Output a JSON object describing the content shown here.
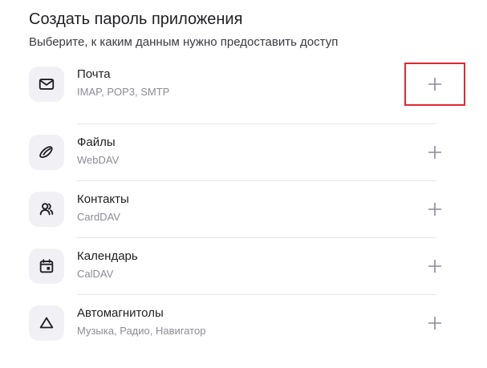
{
  "header": {
    "title": "Создать пароль приложения",
    "subtitle": "Выберите, к каким данным нужно предоставить доступ"
  },
  "accent_highlight_color": "#e0282f",
  "items": [
    {
      "icon": "mail-icon",
      "name": "Почта",
      "desc": "IMAP, POP3, SMTP",
      "action_icon": "plus-icon"
    },
    {
      "icon": "disk-icon",
      "name": "Файлы",
      "desc": "WebDAV",
      "action_icon": "plus-icon"
    },
    {
      "icon": "contacts-icon",
      "name": "Контакты",
      "desc": "CardDAV",
      "action_icon": "plus-icon"
    },
    {
      "icon": "calendar-icon",
      "name": "Календарь",
      "desc": "CalDAV",
      "action_icon": "plus-icon"
    },
    {
      "icon": "navigator-icon",
      "name": "Автомагнитолы",
      "desc": "Музыка, Радио, Навигатор",
      "action_icon": "plus-icon"
    }
  ]
}
